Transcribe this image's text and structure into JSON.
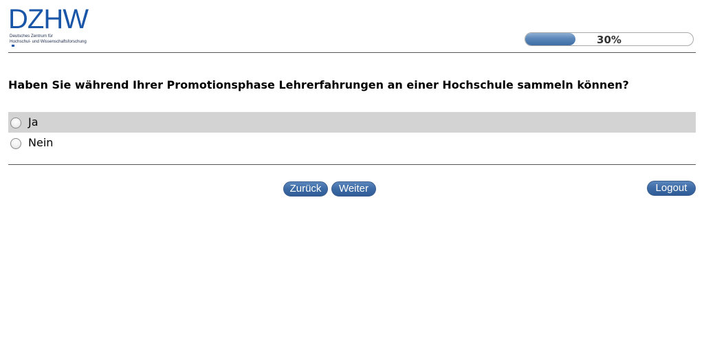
{
  "logo": {
    "main": "DZHW",
    "line1": "Deutsches Zentrum für",
    "line2": "Hochschul- und Wissenschaftsforschung"
  },
  "progress": {
    "percent": 30,
    "label": "30%"
  },
  "question": {
    "text": "Haben Sie während Ihrer Promotionsphase Lehrerfahrungen an einer Hochschule sammeln können?"
  },
  "options": [
    {
      "label": "Ja",
      "selected": false
    },
    {
      "label": "Nein",
      "selected": false
    }
  ],
  "buttons": {
    "back": "Zurück",
    "next": "Weiter",
    "logout": "Logout"
  },
  "colors": {
    "brand": "#1a56a8",
    "button": "#3c6aa5",
    "highlight_row": "#d3d3d3"
  }
}
